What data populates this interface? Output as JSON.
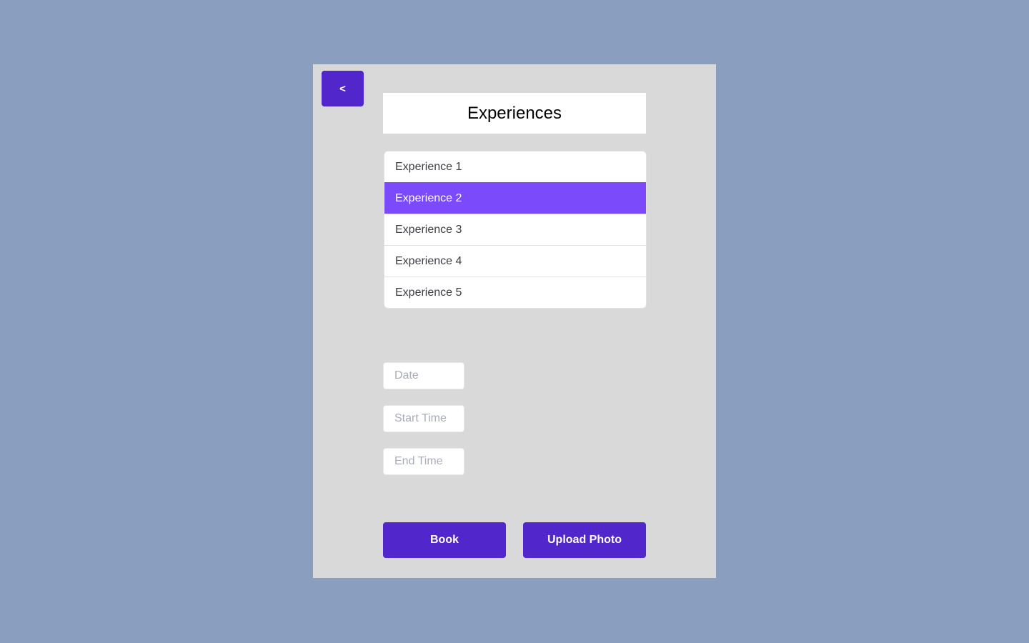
{
  "back_button": {
    "label": "<"
  },
  "title": "Experiences",
  "experiences": [
    {
      "label": "Experience 1",
      "selected": false
    },
    {
      "label": "Experience 2",
      "selected": true
    },
    {
      "label": "Experience 3",
      "selected": false
    },
    {
      "label": "Experience 4",
      "selected": false
    },
    {
      "label": "Experience 5",
      "selected": false
    }
  ],
  "fields": [
    {
      "name": "date-input",
      "placeholder": "Date",
      "value": ""
    },
    {
      "name": "start-time-input",
      "placeholder": "Start Time",
      "value": ""
    },
    {
      "name": "end-time-input",
      "placeholder": "End Time",
      "value": ""
    }
  ],
  "buttons": {
    "book": "Book",
    "upload": "Upload Photo"
  },
  "colors": {
    "background": "#8a9fc0",
    "panel": "#d9d9d9",
    "primary": "#5126cb",
    "selected": "#7b4bfb"
  }
}
